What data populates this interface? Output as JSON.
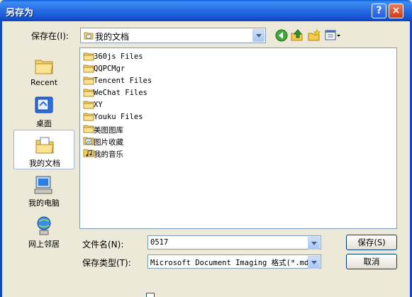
{
  "window": {
    "title": "另存为",
    "help_glyph": "?",
    "close_glyph": "×"
  },
  "savein": {
    "label": "保存在(I):",
    "value": "我的文档"
  },
  "toolbar": {
    "icons": [
      "back-icon",
      "up-folder-icon",
      "new-folder-icon",
      "view-menu-icon"
    ]
  },
  "places": [
    {
      "name": "place-recent",
      "label": "Recent",
      "icon": "recent-icon",
      "active": false
    },
    {
      "name": "place-desktop",
      "label": "桌面",
      "icon": "desktop-icon",
      "active": false
    },
    {
      "name": "place-mydocs",
      "label": "我的文档",
      "icon": "my-documents-icon",
      "active": true
    },
    {
      "name": "place-mycomputer",
      "label": "我的电脑",
      "icon": "my-computer-icon",
      "active": false
    },
    {
      "name": "place-network",
      "label": "网上邻居",
      "icon": "network-icon",
      "active": false
    }
  ],
  "files": [
    {
      "name": "360js Files",
      "icon": "folder-icon"
    },
    {
      "name": "QQPCMgr",
      "icon": "folder-icon"
    },
    {
      "name": "Tencent Files",
      "icon": "folder-icon"
    },
    {
      "name": "WeChat Files",
      "icon": "folder-icon"
    },
    {
      "name": "XY",
      "icon": "folder-icon"
    },
    {
      "name": "Youku Files",
      "icon": "folder-icon"
    },
    {
      "name": "美图图库",
      "icon": "folder-icon"
    },
    {
      "name": "图片收藏",
      "icon": "pictures-folder-icon"
    },
    {
      "name": "我的音乐",
      "icon": "music-folder-icon"
    }
  ],
  "filename": {
    "label": "文件名(N):",
    "value": "0517"
  },
  "filetype": {
    "label": "保存类型(T):",
    "value": "Microsoft Document Imaging 格式(*.mdi"
  },
  "buttons": {
    "save": "保存(S)",
    "cancel": "取消"
  },
  "colors": {
    "titlebar": "#1656d4",
    "dialog_bg": "#ece9d8",
    "close": "#c3401e"
  }
}
